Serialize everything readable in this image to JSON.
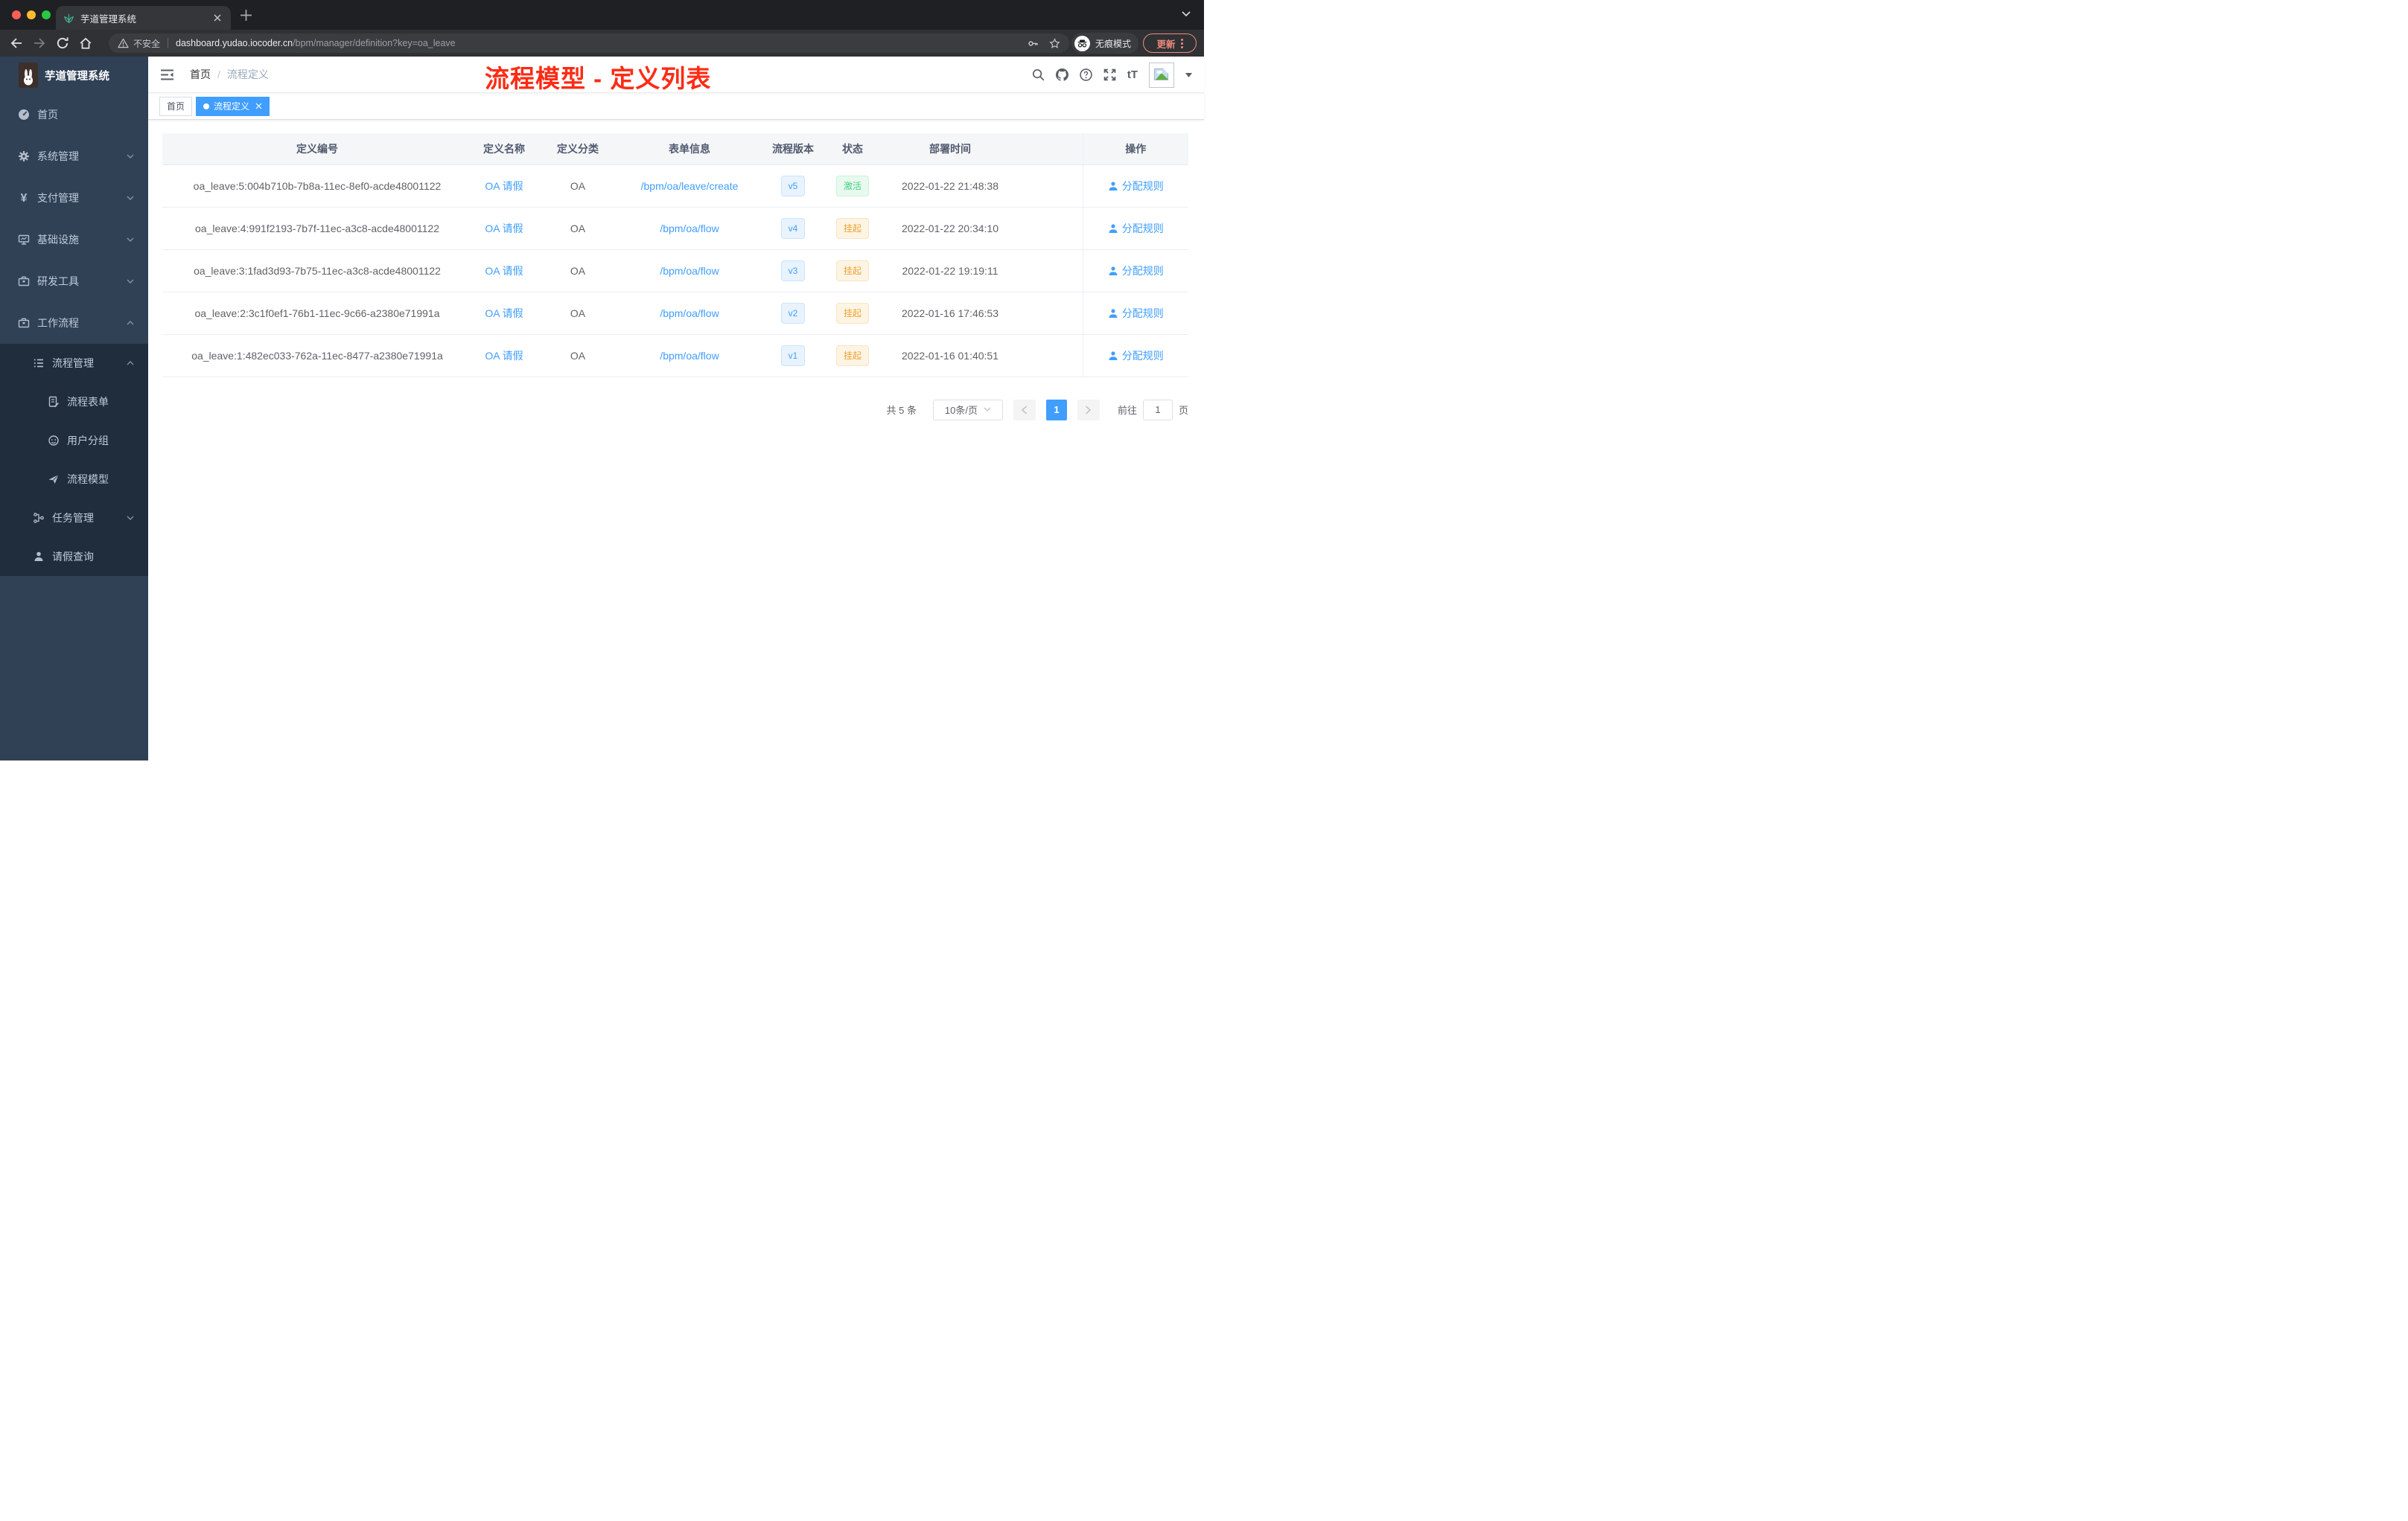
{
  "browser": {
    "tab_title": "芋道管理系统",
    "security_label": "不安全",
    "url_host": "dashboard.yudao.iocoder.cn",
    "url_path": "/bpm/manager/definition?key=oa_leave",
    "incognito_label": "无痕模式",
    "update_label": "更新"
  },
  "sidebar": {
    "title": "芋道管理系统",
    "items": [
      {
        "label": "首页"
      },
      {
        "label": "系统管理"
      },
      {
        "label": "支付管理"
      },
      {
        "label": "基础设施"
      },
      {
        "label": "研发工具"
      },
      {
        "label": "工作流程"
      },
      {
        "label": "流程管理"
      },
      {
        "label": "流程表单"
      },
      {
        "label": "用户分组"
      },
      {
        "label": "流程模型"
      },
      {
        "label": "任务管理"
      },
      {
        "label": "请假查询"
      }
    ]
  },
  "navbar": {
    "breadcrumb_home": "首页",
    "breadcrumb_sep": "/",
    "breadcrumb_current": "流程定义",
    "annotation": "流程模型 - 定义列表",
    "font_icon": "tT"
  },
  "tags": {
    "home": "首页",
    "current": "流程定义"
  },
  "table": {
    "headers": [
      "定义编号",
      "定义名称",
      "定义分类",
      "表单信息",
      "流程版本",
      "状态",
      "部署时间",
      "操作"
    ],
    "rows": [
      {
        "id": "oa_leave:5:004b710b-7b8a-11ec-8ef0-acde48001122",
        "name": "OA 请假",
        "category": "OA",
        "form": "/bpm/oa/leave/create",
        "version": "v5",
        "status": "激活",
        "status_type": "active",
        "time": "2022-01-22 21:48:38",
        "action": "分配规则"
      },
      {
        "id": "oa_leave:4:991f2193-7b7f-11ec-a3c8-acde48001122",
        "name": "OA 请假",
        "category": "OA",
        "form": "/bpm/oa/flow",
        "version": "v4",
        "status": "挂起",
        "status_type": "suspended",
        "time": "2022-01-22 20:34:10",
        "action": "分配规则"
      },
      {
        "id": "oa_leave:3:1fad3d93-7b75-11ec-a3c8-acde48001122",
        "name": "OA 请假",
        "category": "OA",
        "form": "/bpm/oa/flow",
        "version": "v3",
        "status": "挂起",
        "status_type": "suspended",
        "time": "2022-01-22 19:19:11",
        "action": "分配规则"
      },
      {
        "id": "oa_leave:2:3c1f0ef1-76b1-11ec-9c66-a2380e71991a",
        "name": "OA 请假",
        "category": "OA",
        "form": "/bpm/oa/flow",
        "version": "v2",
        "status": "挂起",
        "status_type": "suspended",
        "time": "2022-01-16 17:46:53",
        "action": "分配规则"
      },
      {
        "id": "oa_leave:1:482ec033-762a-11ec-8477-a2380e71991a",
        "name": "OA 请假",
        "category": "OA",
        "form": "/bpm/oa/flow",
        "version": "v1",
        "status": "挂起",
        "status_type": "suspended",
        "time": "2022-01-16 01:40:51",
        "action": "分配规则"
      }
    ]
  },
  "pagination": {
    "total": "共 5 条",
    "page_size": "10条/页",
    "current_page": "1",
    "goto_label": "前往",
    "goto_value": "1",
    "unit_label": "页"
  },
  "colors": {
    "accent": "#409eff",
    "status_active": "#43cf7c",
    "status_suspended": "#efa030",
    "annotation_red": "#fe2b14",
    "sidebar_bg": "#304156",
    "sidebar_submenu_bg": "#1f2d3d"
  }
}
